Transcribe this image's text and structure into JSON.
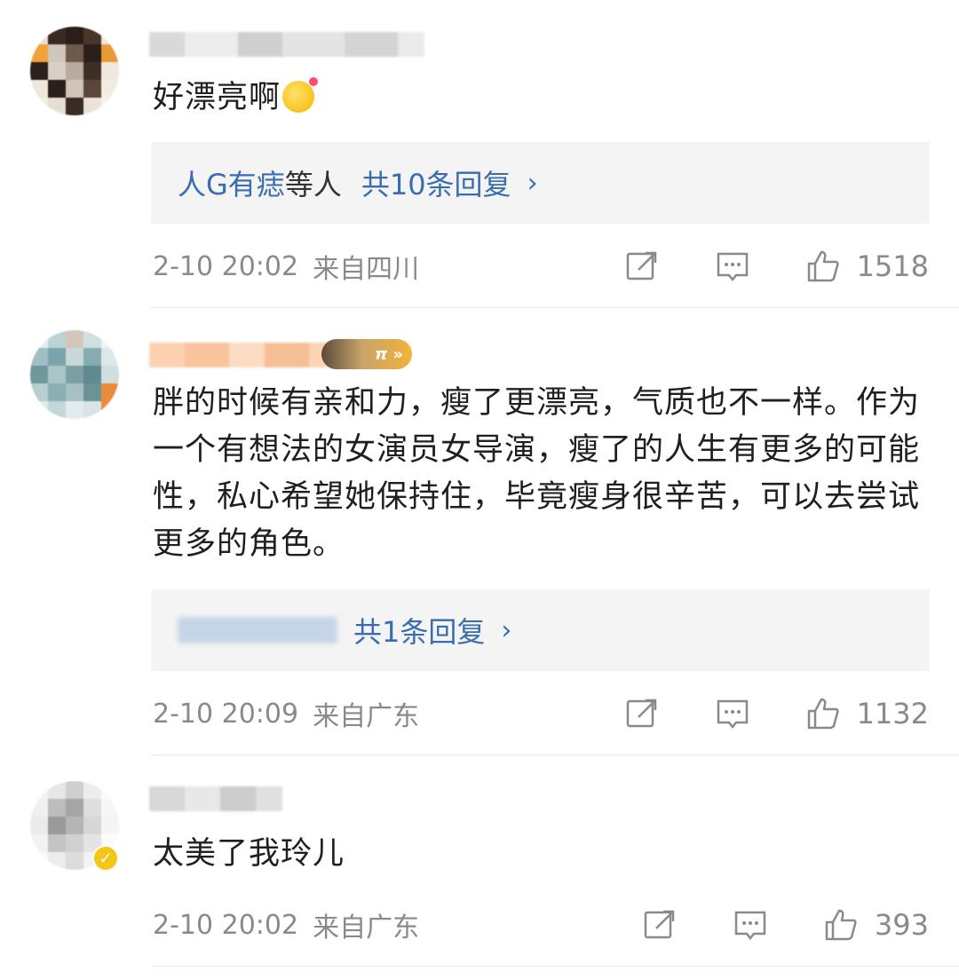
{
  "comments": [
    {
      "text": "好漂亮啊",
      "reply_link": "人G有痣",
      "reply_mid": "等人",
      "reply_count": "共10条回复",
      "time": "2-10 20:02",
      "location": "来自四川",
      "likes": "1518"
    },
    {
      "text": "胖的时候有亲和力，瘦了更漂亮，气质也不一样。作为一个有想法的女演员女导演，瘦了的人生有更多的可能性，私心希望她保持住，毕竟瘦身很辛苦，可以去尝试更多的角色。",
      "badge": "π",
      "reply_count": "共1条回复",
      "time": "2-10 20:09",
      "location": "来自广东",
      "likes": "1132"
    },
    {
      "text": "太美了我玲儿",
      "time": "2-10 20:02",
      "location": "来自广东",
      "likes": "393"
    }
  ],
  "colors": {
    "link": "#3a6cb1",
    "meta": "#8a8a8a",
    "reply_bg": "#f4f4f4"
  },
  "icons": [
    "repost-icon",
    "comment-icon",
    "like-icon",
    "chevron-right-icon"
  ]
}
